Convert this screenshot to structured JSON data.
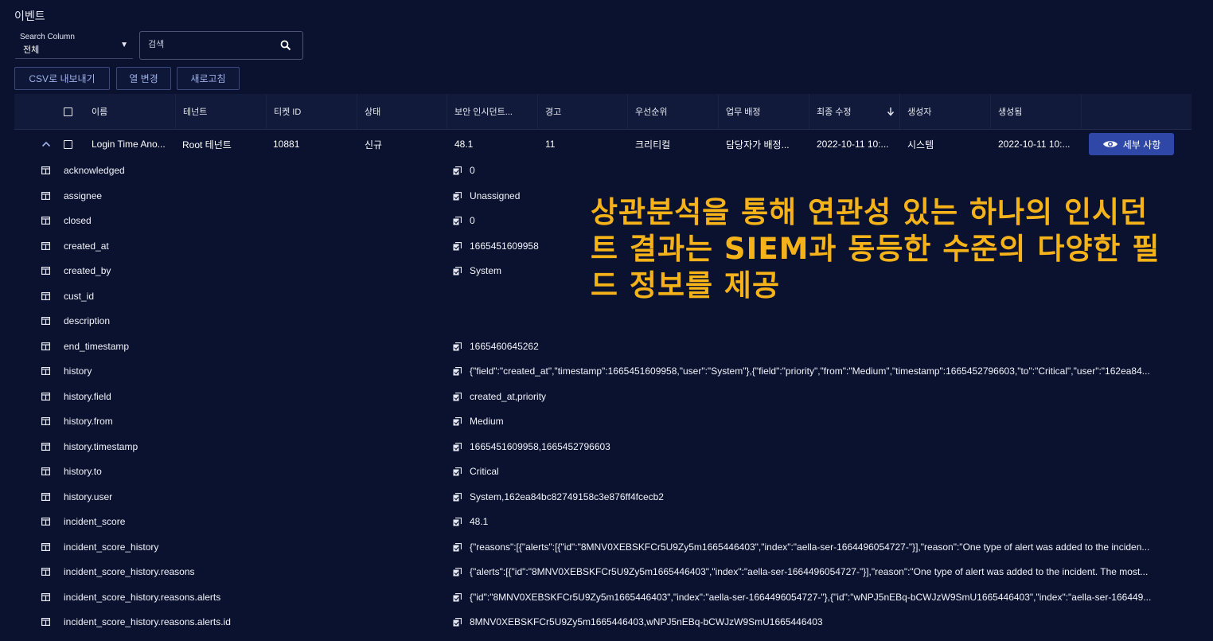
{
  "page": {
    "title": "이벤트"
  },
  "search": {
    "column_label": "Search Column",
    "column_value": "전체",
    "placeholder": "검색"
  },
  "toolbar": {
    "export_csv": "CSV로 내보내기",
    "change_columns": "열 변경",
    "refresh": "새로고침"
  },
  "table": {
    "headers": [
      "이름",
      "테넌트",
      "티켓 ID",
      "상태",
      "보안 인시던트...",
      "경고",
      "우선순위",
      "업무 배정",
      "최종 수정",
      "생성자",
      "생성됨"
    ],
    "row": {
      "name": "Login Time Ano...",
      "tenant": "Root 테넌트",
      "ticket_id": "10881",
      "status": "신규",
      "security_incident": "48.1",
      "alerts": "11",
      "priority": "크리티컬",
      "assignment": "담당자가 배정...",
      "last_modified": "2022-10-11 10:...",
      "created_by": "시스템",
      "created": "2022-10-11 10:...",
      "detail_button": "세부 사항"
    },
    "sort_icon": "arrow-down-icon"
  },
  "fields": [
    {
      "name": "acknowledged",
      "value": "0"
    },
    {
      "name": "assignee",
      "value": "Unassigned"
    },
    {
      "name": "closed",
      "value": "0"
    },
    {
      "name": "created_at",
      "value": "1665451609958"
    },
    {
      "name": "created_by",
      "value": "System"
    },
    {
      "name": "cust_id",
      "value": ""
    },
    {
      "name": "description",
      "value": ""
    },
    {
      "name": "end_timestamp",
      "value": "1665460645262"
    },
    {
      "name": "history",
      "value": "{\"field\":\"created_at\",\"timestamp\":1665451609958,\"user\":\"System\"},{\"field\":\"priority\",\"from\":\"Medium\",\"timestamp\":1665452796603,\"to\":\"Critical\",\"user\":\"162ea84..."
    },
    {
      "name": "history.field",
      "value": "created_at,priority"
    },
    {
      "name": "history.from",
      "value": "Medium"
    },
    {
      "name": "history.timestamp",
      "value": "1665451609958,1665452796603"
    },
    {
      "name": "history.to",
      "value": "Critical"
    },
    {
      "name": "history.user",
      "value": "System,162ea84bc82749158c3e876ff4fcecb2"
    },
    {
      "name": "incident_score",
      "value": "48.1"
    },
    {
      "name": "incident_score_history",
      "value": "{\"reasons\":[{\"alerts\":[{\"id\":\"8MNV0XEBSKFCr5U9Zy5m1665446403\",\"index\":\"aella-ser-1664496054727-\"}],\"reason\":\"One type of alert was added to the inciden..."
    },
    {
      "name": "incident_score_history.reasons",
      "value": "{\"alerts\":[{\"id\":\"8MNV0XEBSKFCr5U9Zy5m1665446403\",\"index\":\"aella-ser-1664496054727-\"}],\"reason\":\"One type of alert was added to the incident. The most..."
    },
    {
      "name": "incident_score_history.reasons.alerts",
      "value": "{\"id\":\"8MNV0XEBSKFCr5U9Zy5m1665446403\",\"index\":\"aella-ser-1664496054727-\"},{\"id\":\"wNPJ5nEBq-bCWJzW9SmU1665446403\",\"index\":\"aella-ser-166449..."
    },
    {
      "name": "incident_score_history.reasons.alerts.id",
      "value": "8MNV0XEBSKFCr5U9Zy5m1665446403,wNPJ5nEBq-bCWJzW9SmU1665446403"
    }
  ],
  "overlay_text": "상관분석을 통해 연관성 있는 하나의 인시던트 결과는 SIEM과 동등한 수준의 다양한 필드 정보를 제공",
  "colors": {
    "background": "#0b1230",
    "accent": "#2f47a6",
    "overlay": "#f5b319"
  }
}
